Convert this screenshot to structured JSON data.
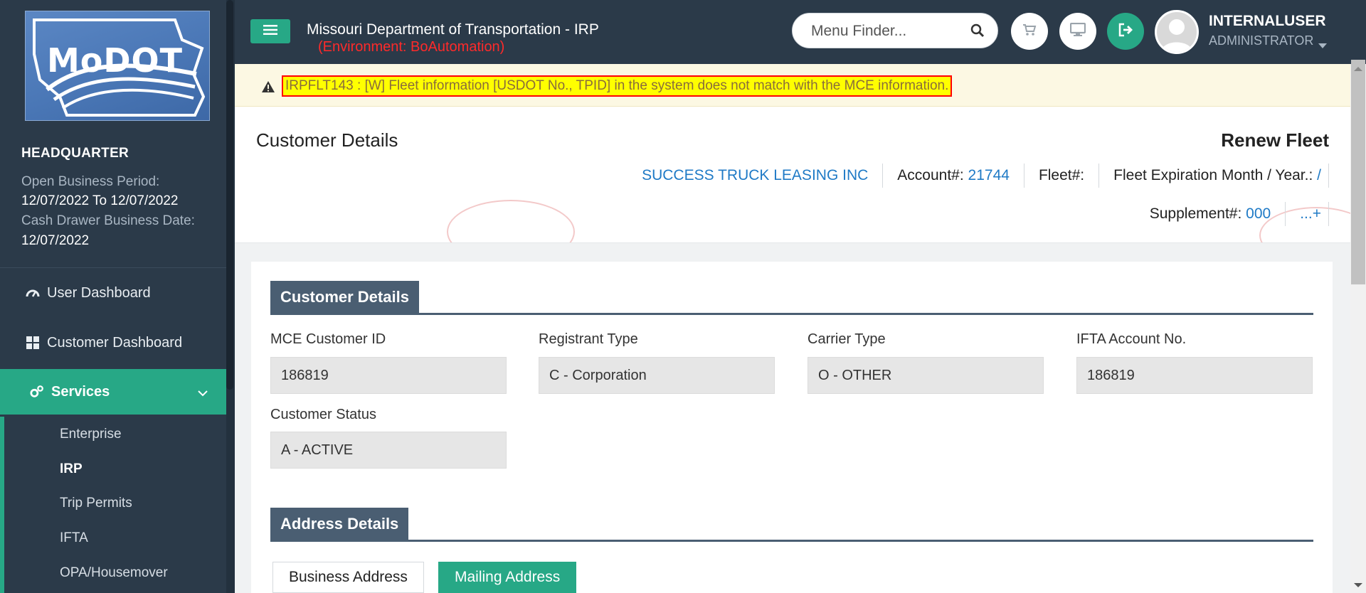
{
  "sidebar": {
    "logo_text": "MoDOT",
    "office": "HEADQUARTER",
    "open_period_label": "Open Business Period:",
    "open_period_value": "12/07/2022 To 12/07/2022",
    "cash_date_label": "Cash Drawer Business Date:",
    "cash_date_value": "12/07/2022",
    "nav": [
      {
        "label": "User Dashboard",
        "icon": "dashboard-gauge-icon"
      },
      {
        "label": "Customer Dashboard",
        "icon": "grid-icon"
      },
      {
        "label": "Services",
        "icon": "gears-icon",
        "active": true
      }
    ],
    "sub_items": [
      "Enterprise",
      "IRP",
      "Trip Permits",
      "IFTA",
      "OPA/Housemover"
    ],
    "active_sub": "IRP"
  },
  "header": {
    "title": "Missouri Department of Transportation - IRP",
    "environment": "(Environment: BoAutomation)",
    "menu_finder_placeholder": "Menu Finder...",
    "user_name": "INTERNALUSER",
    "user_role": "ADMINISTRATOR",
    "icons": [
      "cart-icon",
      "monitor-icon",
      "sign-out-icon"
    ]
  },
  "warning": {
    "message": "IRPFLT143 : [W] Fleet information [USDOT No., TPID] in the system does not match with the MCE information."
  },
  "customer_header": {
    "title": "Customer Details",
    "action_title": "Renew Fleet",
    "company": "SUCCESS TRUCK LEASING INC",
    "account_label": "Account#:",
    "account_value": "21744",
    "fleet_label": "Fleet#:",
    "fleet_value": "",
    "expiration_label": "Fleet Expiration Month / Year.:",
    "expiration_value": "/",
    "supplement_label": "Supplement#:",
    "supplement_value": "000",
    "more_label": "...+"
  },
  "customer_details": {
    "section_title": "Customer Details",
    "fields": [
      {
        "label": "MCE Customer ID",
        "value": "186819"
      },
      {
        "label": "Registrant Type",
        "value": "C - Corporation"
      },
      {
        "label": "Carrier Type",
        "value": "O - OTHER"
      },
      {
        "label": "IFTA Account No.",
        "value": "186819"
      },
      {
        "label": "Customer Status",
        "value": "A - ACTIVE"
      }
    ]
  },
  "address_details": {
    "section_title": "Address Details",
    "tabs": [
      "Business Address",
      "Mailing Address"
    ],
    "active_tab": "Mailing Address"
  },
  "colors": {
    "sidebar_bg": "#2b3a49",
    "accent": "#27a886",
    "env_red": "#ff2a2a",
    "link_blue": "#1f7ac6",
    "warn_highlight": "#ffff00"
  }
}
